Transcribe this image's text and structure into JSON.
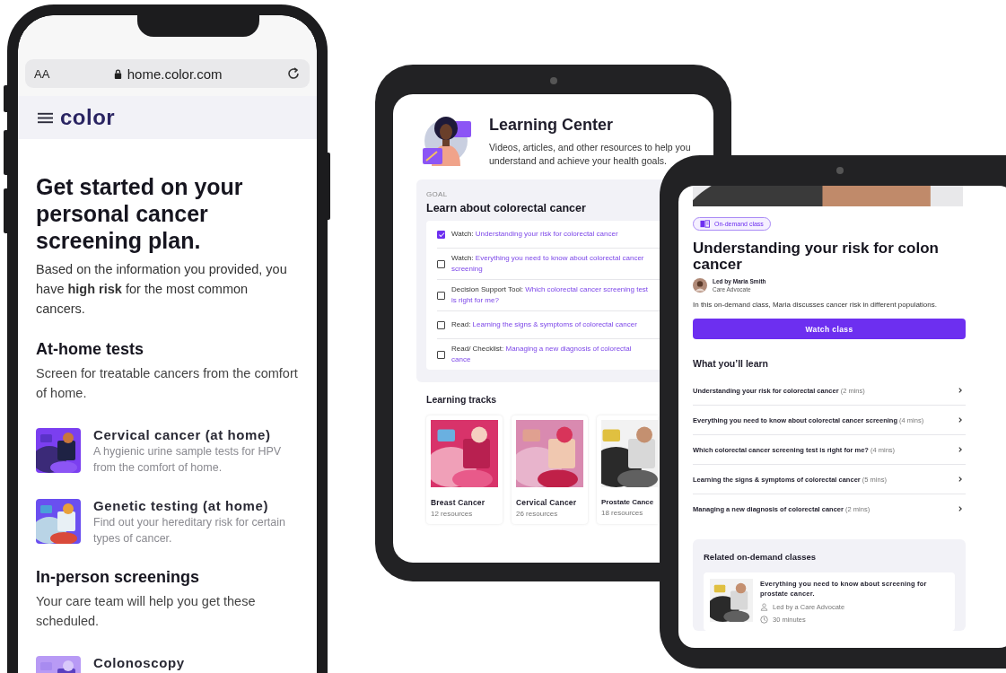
{
  "phone": {
    "browser": {
      "text_size_button": "AA",
      "url": "home.color.com"
    },
    "logo": "color",
    "heading": "Get started on your personal cancer screening plan.",
    "intro": "Based on the information you provided, you have **high risk** for the most common cancers.",
    "sections": [
      {
        "title": "At-home tests",
        "description": "Screen for treatable cancers from the comfort of home.",
        "items": [
          {
            "title": "Cervical cancer (at home)",
            "description": "A hygienic urine sample tests for HPV from the comfort of home.",
            "kind": "picture"
          },
          {
            "title": "Genetic testing (at home)",
            "description": "Find out your hereditary risk for certain types of cancer.",
            "kind": "picture"
          }
        ]
      },
      {
        "title": "In-person screenings",
        "description": "Your care team will help you get these scheduled.",
        "items": [
          {
            "title": "Colonoscopy",
            "kind": "picture"
          }
        ]
      }
    ]
  },
  "learning_center": {
    "title": "Learning Center",
    "subtitle": "Videos, articles, and other resources to help you understand and achieve your health goals.",
    "goal": {
      "label": "GOAL",
      "title": "Learn about colorectal cancer",
      "tasks": [
        {
          "type": "Watch:",
          "link": "Understanding your risk for colorectal cancer",
          "checked": true
        },
        {
          "type": "Watch:",
          "link": "Everything you need to know about colorectal cancer screening",
          "checked": false
        },
        {
          "type": "Decision Support Tool:",
          "link": "Which colorectal cancer screening test is right for me?",
          "checked": false
        },
        {
          "type": "Read:",
          "link": "Learning the signs & symptoms of colorectal cancer",
          "checked": false
        },
        {
          "type": "Read/ Checklist:",
          "link": "Managing a new diagnosis of colorectal cance",
          "checked": false
        }
      ]
    },
    "tracks_title": "Learning tracks",
    "tracks": [
      {
        "title": "Breast Cancer",
        "count": "12 resources"
      },
      {
        "title": "Cervical Cancer",
        "count": "26 resources"
      },
      {
        "title": "Prostate Cance",
        "count": "18 resources"
      }
    ]
  },
  "class_detail": {
    "badge": "On-demand class",
    "title": "Understanding your risk for colon cancer",
    "leader": {
      "name": "Led by Maria Smith",
      "role": "Care Advocate"
    },
    "description": "In this on-demand class, Maria discusses cancer risk in different populations.",
    "button": "Watch class",
    "learn_title": "What you’ll learn",
    "lessons": [
      {
        "title": "Understanding your risk for colorectal cancer",
        "duration": "(2 mins)"
      },
      {
        "title": "Everything you need to know about colorectal cancer screening",
        "duration": "(4 mins)"
      },
      {
        "title": "Which colorectal cancer screening test is right for me?",
        "duration": "(4 mins)"
      },
      {
        "title": "Learning the signs & symptoms of colorectal cancer",
        "duration": "(5 mins)"
      },
      {
        "title": "Managing a new diagnosis of colorectal cancer",
        "duration": "(2 mins)"
      }
    ],
    "related": {
      "title": "Related on-demand classes",
      "items": [
        {
          "title": "Everything you need to know about screening for prostate cancer.",
          "leader": "Led by a Care Advocate",
          "duration": "30 minutes"
        }
      ]
    }
  }
}
